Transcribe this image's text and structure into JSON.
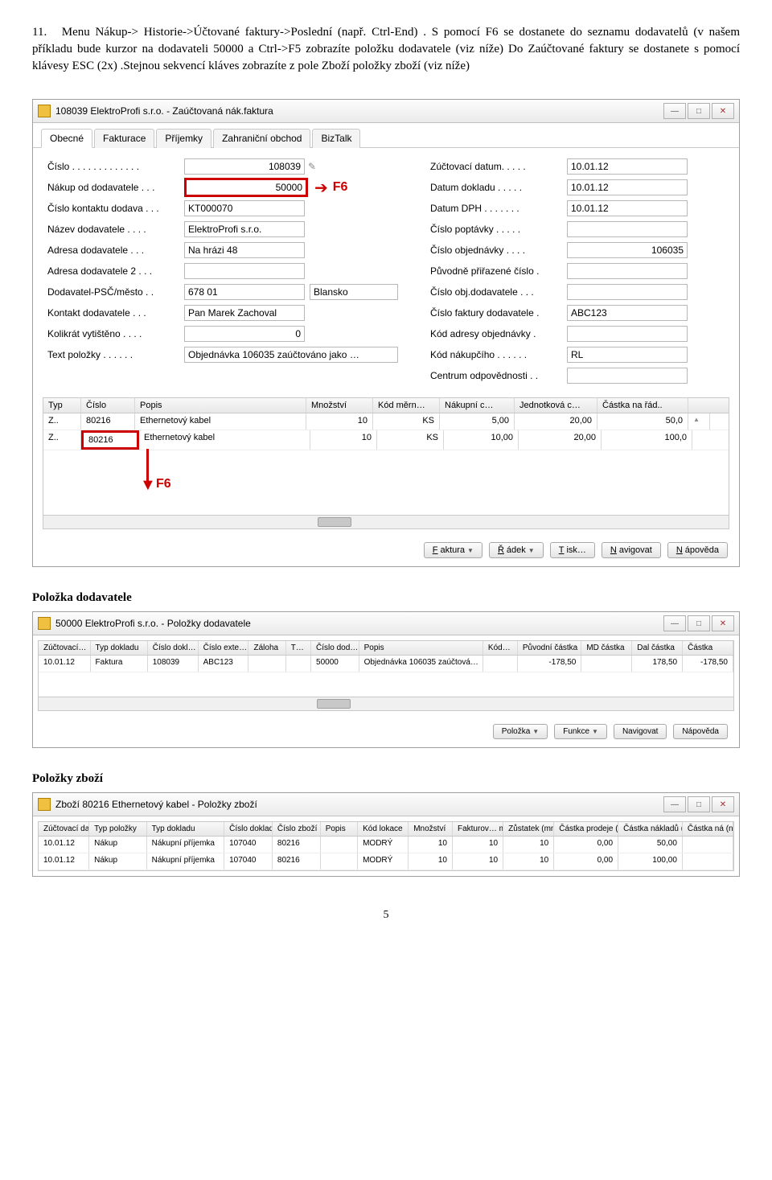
{
  "intro": {
    "num": "11.",
    "text1": "Menu Nákup-> Historie->Účtované faktury->Poslední (např. Ctrl-End) . S pomocí  F6 se dostanete do seznamu dodavatelů (v našem příkladu bude kurzor na dodavateli 50000 a Ctrl->F5 zobrazíte položku dodavatele (viz níže)  Do Zaúčtované faktury se dostanete s pomocí klávesy ESC (2x) .Stejnou sekvencí kláves zobrazíte z pole Zboží položky zboží (viz níže)"
  },
  "win1": {
    "title": "108039 ElektroProfi s.r.o. - Zaúčtovaná nák.faktura",
    "tabs": [
      "Obecné",
      "Fakturace",
      "Příjemky",
      "Zahraniční obchod",
      "BizTalk"
    ],
    "left": [
      {
        "label": "Číslo . . . . . . . . . . . . .",
        "val": "108039",
        "pencil": true,
        "right": true
      },
      {
        "label": "Nákup od dodavatele .  .  .",
        "val": "50000",
        "right": true,
        "hl": true,
        "arrowF6": true
      },
      {
        "label": "Číslo kontaktu dodava . . .",
        "val": "KT000070"
      },
      {
        "label": "Název dodavatele .  .  .  .",
        "val": "ElektroProfi s.r.o."
      },
      {
        "label": "Adresa dodavatele  .  .  .",
        "val": "Na hrázi 48"
      },
      {
        "label": "Adresa dodavatele 2 .  .  .",
        "val": ""
      },
      {
        "label": "Dodavatel-PSČ/město .  .",
        "val": "678 01",
        "extra": "Blansko"
      },
      {
        "label": "Kontakt dodavatele .  .  .",
        "val": "Pan Marek Zachoval"
      },
      {
        "label": "Kolikrát vytištěno .  .  .  .",
        "val": "0",
        "right": true
      },
      {
        "label": "Text položky .  .  .  .  .  .",
        "val": "Objednávka 106035 zaúčtováno jako …",
        "wide": true
      }
    ],
    "right": [
      {
        "label": "Zúčtovací datum.  .  .  .  .",
        "val": "10.01.12"
      },
      {
        "label": "Datum dokladu  .  .  .  .  .",
        "val": "10.01.12"
      },
      {
        "label": "Datum DPH .  .  .  .  .  .  .",
        "val": "10.01.12"
      },
      {
        "label": "Číslo poptávky  .  .  .  .  .",
        "val": ""
      },
      {
        "label": "Číslo objednávky  .  .  .  .",
        "val": "106035",
        "right": true
      },
      {
        "label": "Původně přiřazené číslo .",
        "val": ""
      },
      {
        "label": "Číslo obj.dodavatele .  .  .",
        "val": ""
      },
      {
        "label": "Číslo faktury dodavatele .",
        "val": "ABC123"
      },
      {
        "label": "Kód adresy objednávky  .",
        "val": ""
      },
      {
        "label": "Kód nákupčího .  .  .  .  .  .",
        "val": "RL"
      },
      {
        "label": "Centrum odpovědnosti .  .",
        "val": ""
      }
    ],
    "gridHead": [
      "Typ",
      "Číslo",
      "Popis",
      "Množství",
      "Kód měrn…",
      "Nákupní c…",
      "Jednotková c…",
      "Částka na řád.."
    ],
    "gridRows": [
      [
        "Z..",
        "80216",
        "Ethernetový kabel",
        "10",
        "KS",
        "5,00",
        "20,00",
        "50,0"
      ],
      [
        "Z..",
        "80216",
        "Ethernetový kabel",
        "10",
        "KS",
        "10,00",
        "20,00",
        "100,0"
      ]
    ],
    "row2hl": true,
    "f6down": "F6",
    "buttons": [
      "Faktura",
      "Řádek",
      "Tisk…",
      "Navigovat",
      "Nápověda"
    ]
  },
  "sec2": {
    "heading": "Položka dodavatele",
    "title": "50000 ElektroProfi s.r.o. - Položky dodavatele",
    "head": [
      "Zúčtovací…",
      "Typ dokladu",
      "Číslo dokl…",
      "Číslo exte…",
      "Záloha",
      "T…",
      "Číslo dod…",
      "Popis",
      "Kód…",
      "Původní částka",
      "MD částka",
      "Dal částka",
      "Částka"
    ],
    "row": [
      "10.01.12",
      "Faktura",
      "108039",
      "ABC123",
      "",
      "",
      "50000",
      "Objednávka 106035 zaúčtová…",
      "",
      "-178,50",
      "",
      "178,50",
      "-178,50"
    ],
    "buttons": [
      "Položka",
      "Funkce",
      "Navigovat",
      "Nápověda"
    ]
  },
  "sec3": {
    "heading": "Položky zboží",
    "title": "Zboží 80216 Ethernetový kabel - Položky zboží",
    "head": [
      "Zúčtovací datum",
      "Typ položky",
      "Typ dokladu",
      "Číslo dokladu",
      "Číslo zboží",
      "Popis",
      "Kód lokace",
      "Množství",
      "Fakturov… množství",
      "Zůstatek (množství)",
      "Částka prodeje (skutečná)",
      "Částka nákladů (skutečná)",
      "Částka ná (neinv.)"
    ],
    "rows": [
      [
        "10.01.12",
        "Nákup",
        "Nákupní příjemka",
        "107040",
        "80216",
        "",
        "MODRÝ",
        "10",
        "10",
        "10",
        "0,00",
        "50,00",
        ""
      ],
      [
        "10.01.12",
        "Nákup",
        "Nákupní příjemka",
        "107040",
        "80216",
        "",
        "MODRÝ",
        "10",
        "10",
        "10",
        "0,00",
        "100,00",
        ""
      ]
    ]
  },
  "pagenum": "5"
}
